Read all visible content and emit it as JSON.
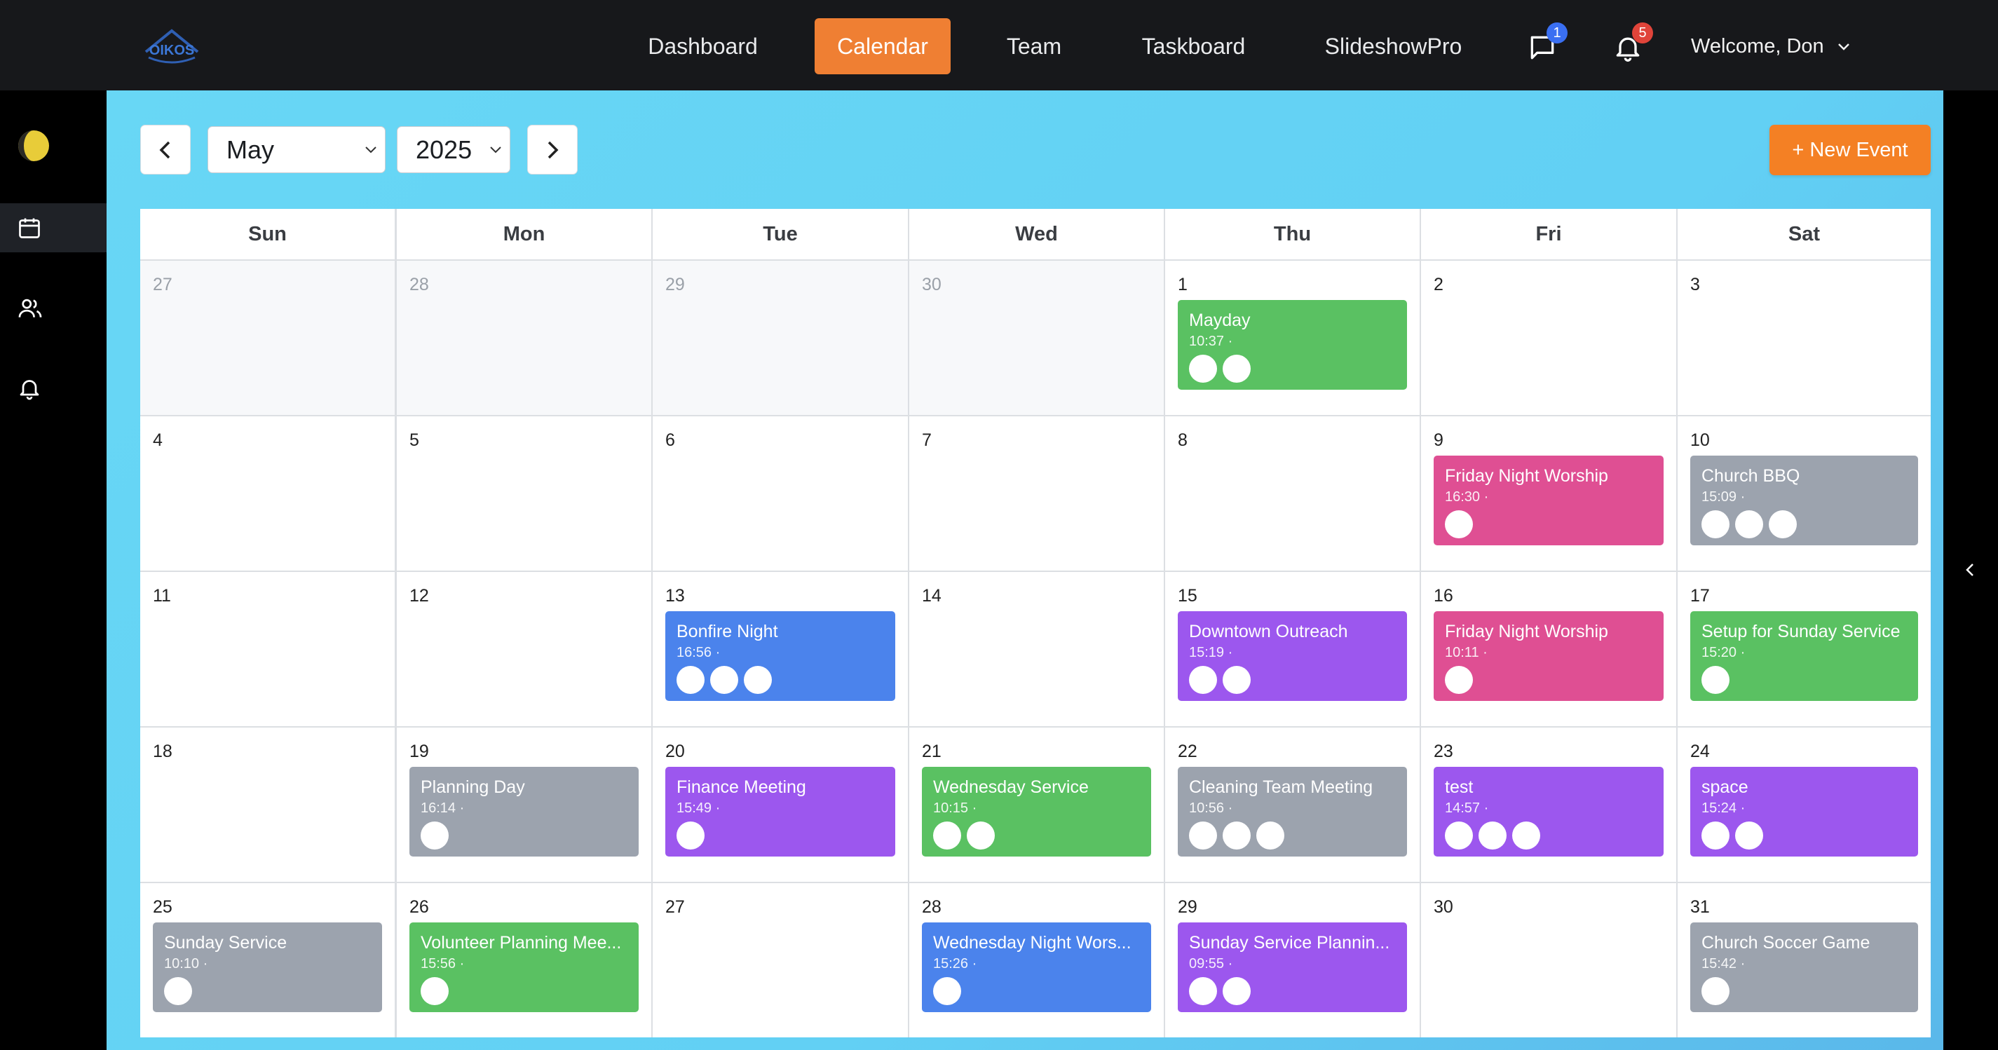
{
  "app": {
    "logo_text": "OIKOS"
  },
  "nav": {
    "items": [
      "Dashboard",
      "Calendar",
      "Team",
      "Taskboard",
      "SlideshowPro"
    ],
    "active": "Calendar",
    "messages_badge": "1",
    "notifications_badge": "5",
    "welcome": "Welcome, Don"
  },
  "controls": {
    "month": "May",
    "year": "2025",
    "new_event": "+ New Event"
  },
  "weekdays": [
    "Sun",
    "Mon",
    "Tue",
    "Wed",
    "Thu",
    "Fri",
    "Sat"
  ],
  "colors": {
    "green": "#5ac162",
    "pink": "#df4f93",
    "gray": "#9ca3ae",
    "blue": "#4b83ec",
    "purple": "#9c57ee",
    "accent": "#ef7f33"
  },
  "weeks": [
    [
      {
        "day": "27",
        "other": true
      },
      {
        "day": "28",
        "other": true
      },
      {
        "day": "29",
        "other": true
      },
      {
        "day": "30",
        "other": true
      },
      {
        "day": "1",
        "event": {
          "title": "Mayday",
          "time": "10:37 ·",
          "color": "green",
          "avatars": 2
        }
      },
      {
        "day": "2"
      },
      {
        "day": "3"
      }
    ],
    [
      {
        "day": "4"
      },
      {
        "day": "5"
      },
      {
        "day": "6"
      },
      {
        "day": "7"
      },
      {
        "day": "8"
      },
      {
        "day": "9",
        "event": {
          "title": "Friday Night Worship",
          "time": "16:30 ·",
          "color": "pink",
          "avatars": 1
        }
      },
      {
        "day": "10",
        "event": {
          "title": "Church BBQ",
          "time": "15:09 ·",
          "color": "gray",
          "avatars": 3
        }
      }
    ],
    [
      {
        "day": "11"
      },
      {
        "day": "12"
      },
      {
        "day": "13",
        "event": {
          "title": "Bonfire Night",
          "time": "16:56 ·",
          "color": "blue",
          "avatars": 3
        }
      },
      {
        "day": "14"
      },
      {
        "day": "15",
        "event": {
          "title": "Downtown Outreach",
          "time": "15:19 ·",
          "color": "purple",
          "avatars": 2
        }
      },
      {
        "day": "16",
        "event": {
          "title": "Friday Night Worship",
          "time": "10:11 ·",
          "color": "pink",
          "avatars": 1
        }
      },
      {
        "day": "17",
        "event": {
          "title": "Setup for Sunday Service",
          "time": "15:20 ·",
          "color": "green",
          "avatars": 1
        }
      }
    ],
    [
      {
        "day": "18"
      },
      {
        "day": "19",
        "event": {
          "title": "Planning Day",
          "time": "16:14 ·",
          "color": "gray",
          "avatars": 1
        }
      },
      {
        "day": "20",
        "event": {
          "title": "Finance Meeting",
          "time": "15:49 ·",
          "color": "purple",
          "avatars": 1
        }
      },
      {
        "day": "21",
        "event": {
          "title": "Wednesday Service",
          "time": "10:15 ·",
          "color": "green",
          "avatars": 2
        }
      },
      {
        "day": "22",
        "event": {
          "title": "Cleaning Team Meeting",
          "time": "10:56 ·",
          "color": "gray",
          "avatars": 3
        }
      },
      {
        "day": "23",
        "event": {
          "title": "test",
          "time": "14:57 ·",
          "color": "purple",
          "avatars": 3
        }
      },
      {
        "day": "24",
        "event": {
          "title": "space",
          "time": "15:24 ·",
          "color": "purple",
          "avatars": 2
        }
      }
    ],
    [
      {
        "day": "25",
        "event": {
          "title": "Sunday Service",
          "time": "10:10 ·",
          "color": "gray",
          "avatars": 1
        }
      },
      {
        "day": "26",
        "event": {
          "title": "Volunteer Planning Mee...",
          "time": "15:56 ·",
          "color": "green",
          "avatars": 1
        }
      },
      {
        "day": "27"
      },
      {
        "day": "28",
        "event": {
          "title": "Wednesday Night Wors...",
          "time": "15:26 ·",
          "color": "blue",
          "avatars": 1
        }
      },
      {
        "day": "29",
        "event": {
          "title": "Sunday Service Plannin...",
          "time": "09:55 ·",
          "color": "purple",
          "avatars": 2
        }
      },
      {
        "day": "30"
      },
      {
        "day": "31",
        "event": {
          "title": "Church Soccer Game",
          "time": "15:42 ·",
          "color": "gray",
          "avatars": 1
        }
      }
    ]
  ]
}
